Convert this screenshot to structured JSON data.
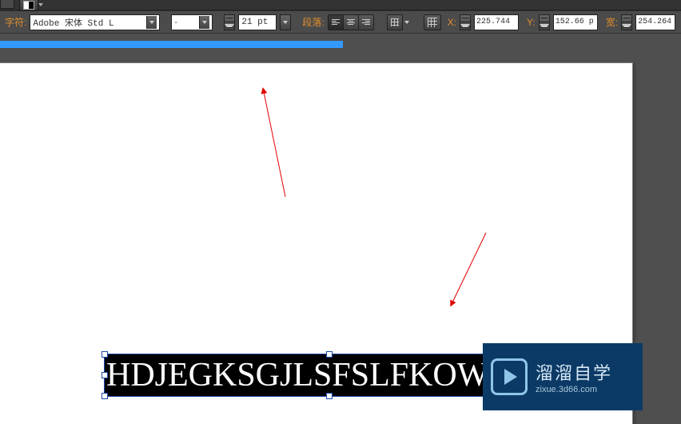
{
  "topbar": {},
  "options": {
    "font_label": "字符:",
    "font_name": "Adobe 宋体 Std L",
    "font_style": "-",
    "size_value": "21 pt",
    "para_label": "段落:",
    "x_label": "X:",
    "x_value": "225.744 ",
    "y_label": "Y:",
    "y_value": "152.66 p",
    "w_label": "宽:",
    "w_value": "254.264"
  },
  "canvas": {
    "sample_text": "HDJEGKSGJLSFSLFKOWEJF"
  },
  "watermark": {
    "title": "溜溜自学",
    "subtitle": "zixue.3d66.com"
  }
}
